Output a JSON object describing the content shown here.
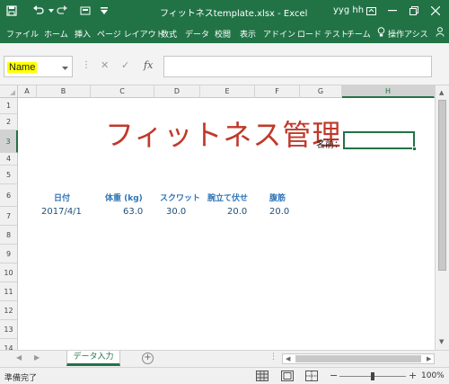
{
  "window": {
    "title": "フィットネスtemplate.xlsx - Excel",
    "user": "yyg hh"
  },
  "ribbon": {
    "tabs": [
      "ファイル",
      "ホーム",
      "挿入",
      "ページ レイアウト",
      "数式",
      "データ",
      "校閲",
      "表示",
      "アドイン",
      "ロード テスト",
      "チーム"
    ],
    "tell_me": "操作アシス"
  },
  "formula_bar": {
    "name_box": "Name",
    "fx_label": "fx",
    "formula": ""
  },
  "sheet": {
    "columns": [
      "A",
      "B",
      "C",
      "D",
      "E",
      "F",
      "G",
      "H"
    ],
    "rows": [
      "1",
      "2",
      "3",
      "4",
      "5",
      "6",
      "7",
      "8",
      "9",
      "10",
      "11",
      "12",
      "13",
      "14"
    ],
    "selected_column": "H",
    "selected_row": "3",
    "title": "フィットネス管理",
    "name_label": "名前：",
    "headers": [
      "日付",
      "体重 (kg)",
      "スクワット",
      "腕立て伏せ",
      "腹筋"
    ],
    "record": [
      "2017/4/1",
      "63.0",
      "30.0",
      "20.0",
      "20.0"
    ]
  },
  "tabs": {
    "active_sheet": "データ入力"
  },
  "status": {
    "text": "準備完了",
    "zoom": "100%",
    "zoom_level": 1.0
  },
  "colors": {
    "accent": "#217346",
    "title_red": "#c0392b",
    "header_blue": "#2e75b6",
    "highlight": "#ffff00"
  }
}
